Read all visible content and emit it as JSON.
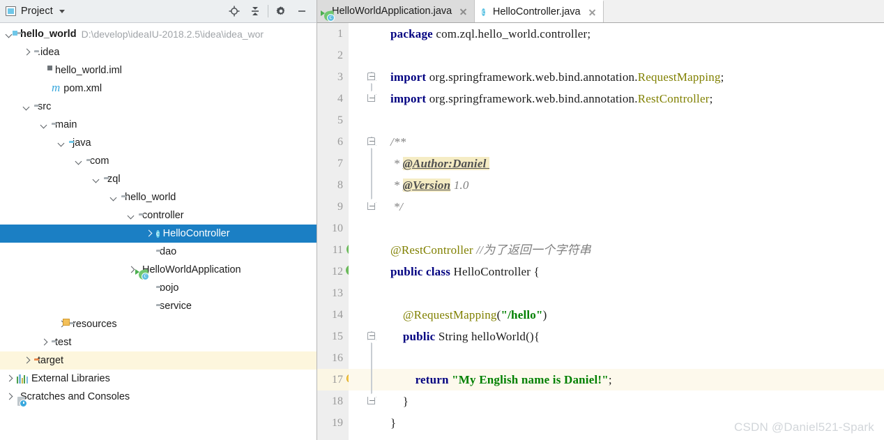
{
  "project_panel": {
    "title": "Project",
    "title_dropdown_icon": "chevron-down-icon",
    "toolbar": [
      {
        "name": "locate-icon",
        "label": ""
      },
      {
        "name": "collapse-all-icon",
        "label": ""
      },
      {
        "name": "gear-icon",
        "label": ""
      },
      {
        "name": "minimize-icon",
        "label": ""
      }
    ],
    "tree": [
      {
        "label": "hello_world",
        "path": "D:\\develop\\ideaIU-2018.2.5\\idea\\idea_wor",
        "indent": 0,
        "arrow": "down",
        "icon": "module-folder-icon",
        "bold": true,
        "state": "normal"
      },
      {
        "label": ".idea",
        "path": "",
        "indent": 1,
        "arrow": "right",
        "icon": "folder-icon",
        "bold": false,
        "state": "normal"
      },
      {
        "label": "hello_world.iml",
        "path": "",
        "indent": 2,
        "arrow": "none",
        "icon": "iml-file-icon",
        "bold": false,
        "state": "normal"
      },
      {
        "label": "pom.xml",
        "path": "",
        "indent": 2,
        "arrow": "none",
        "icon": "maven-pom-icon",
        "bold": false,
        "state": "normal"
      },
      {
        "label": "src",
        "path": "",
        "indent": 1,
        "arrow": "down",
        "icon": "folder-icon",
        "bold": false,
        "state": "normal"
      },
      {
        "label": "main",
        "path": "",
        "indent": 2,
        "arrow": "down",
        "icon": "folder-icon",
        "bold": false,
        "state": "normal"
      },
      {
        "label": "java",
        "path": "",
        "indent": 3,
        "arrow": "down",
        "icon": "source-folder-icon",
        "bold": false,
        "state": "normal"
      },
      {
        "label": "com",
        "path": "",
        "indent": 4,
        "arrow": "down",
        "icon": "package-icon",
        "bold": false,
        "state": "normal"
      },
      {
        "label": "zql",
        "path": "",
        "indent": 5,
        "arrow": "down",
        "icon": "package-icon",
        "bold": false,
        "state": "normal"
      },
      {
        "label": "hello_world",
        "path": "",
        "indent": 6,
        "arrow": "down",
        "icon": "package-icon",
        "bold": false,
        "state": "normal"
      },
      {
        "label": "controller",
        "path": "",
        "indent": 7,
        "arrow": "down",
        "icon": "package-icon",
        "bold": false,
        "state": "normal"
      },
      {
        "label": "HelloController",
        "path": "",
        "indent": 8,
        "arrow": "right",
        "icon": "java-class-icon",
        "bold": false,
        "state": "selected"
      },
      {
        "label": "dao",
        "path": "",
        "indent": 8,
        "arrow": "none",
        "icon": "package-icon",
        "bold": false,
        "state": "normal"
      },
      {
        "label": "HelloWorldApplication",
        "path": "",
        "indent": 7,
        "arrow": "right",
        "icon": "spring-boot-app-icon",
        "bold": false,
        "state": "normal"
      },
      {
        "label": "pojo",
        "path": "",
        "indent": 8,
        "arrow": "none",
        "icon": "package-icon",
        "bold": false,
        "state": "normal"
      },
      {
        "label": "service",
        "path": "",
        "indent": 8,
        "arrow": "none",
        "icon": "package-icon",
        "bold": false,
        "state": "normal"
      },
      {
        "label": "resources",
        "path": "",
        "indent": 3,
        "arrow": "right",
        "icon": "resources-folder-icon",
        "bold": false,
        "state": "normal"
      },
      {
        "label": "test",
        "path": "",
        "indent": 2,
        "arrow": "right",
        "icon": "folder-icon",
        "bold": false,
        "state": "normal"
      },
      {
        "label": "target",
        "path": "",
        "indent": 1,
        "arrow": "right",
        "icon": "excluded-folder-icon",
        "bold": false,
        "state": "highlighted"
      },
      {
        "label": "External Libraries",
        "path": "",
        "indent": 0,
        "arrow": "right",
        "icon": "external-libraries-icon",
        "bold": false,
        "state": "normal"
      },
      {
        "label": "Scratches and Consoles",
        "path": "",
        "indent": 0,
        "arrow": "right",
        "icon": "scratches-icon",
        "bold": false,
        "state": "normal"
      }
    ]
  },
  "editor": {
    "tabs": [
      {
        "label": "HelloWorldApplication.java",
        "icon": "spring-boot-app-icon",
        "active": false
      },
      {
        "label": "HelloController.java",
        "icon": "java-class-icon",
        "active": true
      }
    ],
    "current_line": 17,
    "line_numbers": [
      1,
      2,
      3,
      4,
      5,
      6,
      7,
      8,
      9,
      10,
      11,
      12,
      13,
      14,
      15,
      16,
      17,
      18,
      19
    ],
    "gutter_icons": [
      {
        "line": 11,
        "name": "spring-bean-check-icon"
      },
      {
        "line": 12,
        "name": "spring-bean-class-icon"
      },
      {
        "line": 17,
        "name": "intention-bulb-icon"
      }
    ],
    "fold_markers": [
      {
        "line": 3,
        "type": "top"
      },
      {
        "line": 4,
        "type": "bottom"
      },
      {
        "line": 6,
        "type": "top"
      },
      {
        "line": 9,
        "type": "bottom"
      },
      {
        "line": 15,
        "type": "top"
      },
      {
        "line": 18,
        "type": "bottom"
      }
    ],
    "code_lines": [
      {
        "n": 1,
        "tokens": [
          {
            "t": "package",
            "c": "kw"
          },
          {
            "t": " com.zql.hello_world.controller;",
            "c": "plain"
          }
        ]
      },
      {
        "n": 2,
        "tokens": []
      },
      {
        "n": 3,
        "tokens": [
          {
            "t": "import",
            "c": "kw"
          },
          {
            "t": " org.springframework.web.bind.annotation.",
            "c": "plain"
          },
          {
            "t": "RequestMapping",
            "c": "ann"
          },
          {
            "t": ";",
            "c": "plain"
          }
        ]
      },
      {
        "n": 4,
        "tokens": [
          {
            "t": "import",
            "c": "kw"
          },
          {
            "t": " org.springframework.web.bind.annotation.",
            "c": "plain"
          },
          {
            "t": "RestController",
            "c": "ann"
          },
          {
            "t": ";",
            "c": "plain"
          }
        ]
      },
      {
        "n": 5,
        "tokens": []
      },
      {
        "n": 6,
        "tokens": [
          {
            "t": "/**",
            "c": "doc"
          }
        ]
      },
      {
        "n": 7,
        "tokens": [
          {
            "t": " * ",
            "c": "doc"
          },
          {
            "t": "@Author:Daniel",
            "c": "doctag"
          },
          {
            "t": " ",
            "c": "doctag"
          }
        ]
      },
      {
        "n": 8,
        "tokens": [
          {
            "t": " * ",
            "c": "doc"
          },
          {
            "t": "@Version",
            "c": "doctag"
          },
          {
            "t": " 1.0",
            "c": "doc"
          }
        ]
      },
      {
        "n": 9,
        "tokens": [
          {
            "t": " */",
            "c": "doc"
          }
        ]
      },
      {
        "n": 10,
        "tokens": []
      },
      {
        "n": 11,
        "tokens": [
          {
            "t": "@RestController",
            "c": "ann"
          },
          {
            "t": " ",
            "c": "plain"
          },
          {
            "t": "//为了返回一个字符串",
            "c": "cmt"
          }
        ]
      },
      {
        "n": 12,
        "tokens": [
          {
            "t": "public class",
            "c": "kw"
          },
          {
            "t": " HelloController {",
            "c": "plain"
          }
        ]
      },
      {
        "n": 13,
        "tokens": []
      },
      {
        "n": 14,
        "tokens": [
          {
            "t": "    ",
            "c": "plain"
          },
          {
            "t": "@RequestMapping",
            "c": "ann"
          },
          {
            "t": "(",
            "c": "plain"
          },
          {
            "t": "\"/hello\"",
            "c": "str"
          },
          {
            "t": ")",
            "c": "plain"
          }
        ]
      },
      {
        "n": 15,
        "tokens": [
          {
            "t": "    ",
            "c": "plain"
          },
          {
            "t": "public",
            "c": "kw"
          },
          {
            "t": " String helloWorld(){",
            "c": "plain"
          }
        ]
      },
      {
        "n": 16,
        "tokens": []
      },
      {
        "n": 17,
        "tokens": [
          {
            "t": "        ",
            "c": "plain"
          },
          {
            "t": "return",
            "c": "kw"
          },
          {
            "t": " ",
            "c": "plain"
          },
          {
            "t": "\"My English name is Daniel!\"",
            "c": "str"
          },
          {
            "t": ";",
            "c": "plain"
          }
        ]
      },
      {
        "n": 18,
        "tokens": [
          {
            "t": "    }",
            "c": "plain"
          }
        ]
      },
      {
        "n": 19,
        "tokens": [
          {
            "t": "}",
            "c": "plain"
          }
        ]
      }
    ]
  },
  "watermark": "CSDN @Daniel521-Spark",
  "colors": {
    "selection_blue": "#1b7fc4",
    "highlight_yellow": "#fdf6dd",
    "caret_line": "#fdf9ec",
    "keyword": "#000080",
    "string": "#008000",
    "annotation": "#808000",
    "comment": "#808080",
    "gutter_bg": "#eeeeee",
    "panel_bg": "#eceff1"
  }
}
